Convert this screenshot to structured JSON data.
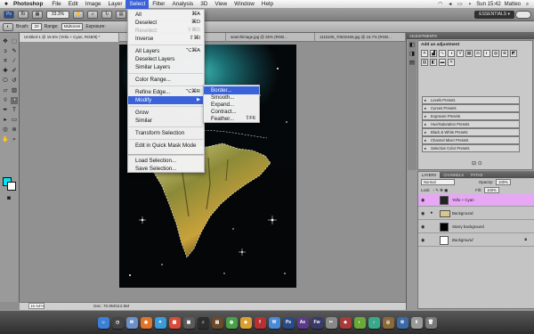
{
  "menubar": {
    "app": "Photoshop",
    "items": [
      "File",
      "Edit",
      "Image",
      "Layer",
      "Select",
      "Filter",
      "Analysis",
      "3D",
      "View",
      "Window",
      "Help"
    ],
    "clock": "Sun 15:42",
    "user": "Matteo"
  },
  "appbar": {
    "zoom": "33.3%",
    "workspace": "ESSENTIALS ▾"
  },
  "options": {
    "brush_label": "Brush:",
    "brush_size": "20",
    "range_label": "Range:",
    "range_value": "Midtones",
    "exposure_label": "Exposure:"
  },
  "tabs": [
    "Untitled-1 @ 16.5% (Yello + Cyan, RGB/8) *",
    "",
    "searchimage.jpg @ 25% (RGB...",
    "1115105_70632465.jpg @ 16.7% (RGB..."
  ],
  "select_menu": {
    "all": {
      "label": "All",
      "shortcut": "⌘A"
    },
    "deselect": {
      "label": "Deselect",
      "shortcut": "⌘D"
    },
    "reselect": {
      "label": "Reselect",
      "shortcut": "⇧⌘D"
    },
    "inverse": {
      "label": "Inverse",
      "shortcut": "⇧⌘I"
    },
    "all_layers": {
      "label": "All Layers",
      "shortcut": "⌥⌘A"
    },
    "deselect_layers": {
      "label": "Deselect Layers"
    },
    "similar_layers": {
      "label": "Similar Layers"
    },
    "color_range": {
      "label": "Color Range..."
    },
    "refine_edge": {
      "label": "Refine Edge...",
      "shortcut": "⌥⌘R"
    },
    "modify": {
      "label": "Modify"
    },
    "grow": {
      "label": "Grow"
    },
    "similar": {
      "label": "Similar"
    },
    "transform": {
      "label": "Transform Selection"
    },
    "quick_mask": {
      "label": "Edit in Quick Mask Mode"
    },
    "load": {
      "label": "Load Selection..."
    },
    "save": {
      "label": "Save Selection..."
    }
  },
  "modify_submenu": {
    "border": "Border...",
    "smooth": "Smooth...",
    "expand": "Expand...",
    "contract": "Contract...",
    "feather": {
      "label": "Feather...",
      "shortcut": "⇧F6"
    }
  },
  "status": {
    "zoom": "16.54%",
    "doc": "Doc: 70.8M/112.5M"
  },
  "adjustments": {
    "header": "ADJUSTMENTS",
    "title": "Add an adjustment",
    "presets": [
      "Levels Presets",
      "Curves Presets",
      "Exposure Presets",
      "Hue/Saturation Presets",
      "Black & White Presets",
      "Channel Mixer Presets",
      "Selective Color Presets"
    ]
  },
  "layers_panel": {
    "tabs": [
      "LAYERS",
      "CHANNELS",
      "PATHS"
    ],
    "blend": "Normal",
    "opacity_label": "Opacity:",
    "opacity": "100%",
    "lock_label": "Lock:",
    "fill_label": "Fill:",
    "fill": "100%",
    "layers": [
      {
        "name": "Yello + Cyan",
        "selected": true
      },
      {
        "name": "Background",
        "group": true
      },
      {
        "name": "Starry background"
      },
      {
        "name": "Background",
        "locked": true
      }
    ]
  },
  "colors": {
    "foreground": "#00e5f5",
    "menu_highlight": "#3a62d9",
    "layer_highlight": "#e6a8f4"
  }
}
